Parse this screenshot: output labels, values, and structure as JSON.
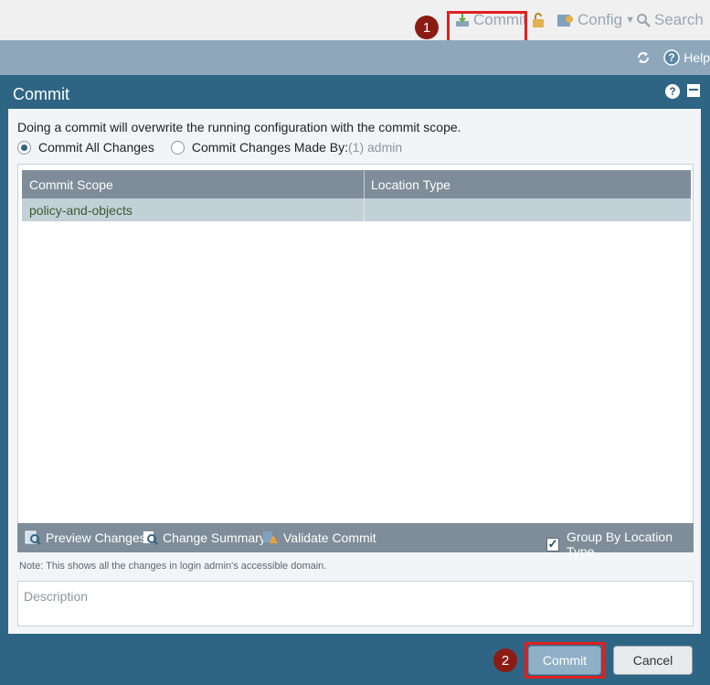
{
  "toolbar": {
    "commit_label": "Commit",
    "config_label": "Config",
    "search_label": "Search",
    "callout_1": "1"
  },
  "subbar": {
    "help_label": "Help"
  },
  "dialog": {
    "title": "Commit",
    "intro": "Doing a commit will overwrite the running configuration with the commit scope.",
    "radio_all_label": "Commit All Changes",
    "radio_by_label": "Commit Changes Made By:",
    "radio_by_value": "(1) admin",
    "table": {
      "columns": [
        "Commit Scope",
        "Location Type"
      ],
      "rows": [
        [
          "policy-and-objects",
          ""
        ]
      ]
    },
    "actions": {
      "preview": "Preview Changes",
      "summary": "Change Summary",
      "validate": "Validate Commit",
      "group_by": "Group By Location Type"
    },
    "note": "Note: This shows all the changes in login admin's accessible domain.",
    "description_placeholder": "Description",
    "commit_button": "Commit",
    "cancel_button": "Cancel",
    "callout_2": "2"
  },
  "colors": {
    "dialog_bg": "#2f6584",
    "callout_red": "#8b1c14",
    "highlight_red": "#e02020"
  }
}
